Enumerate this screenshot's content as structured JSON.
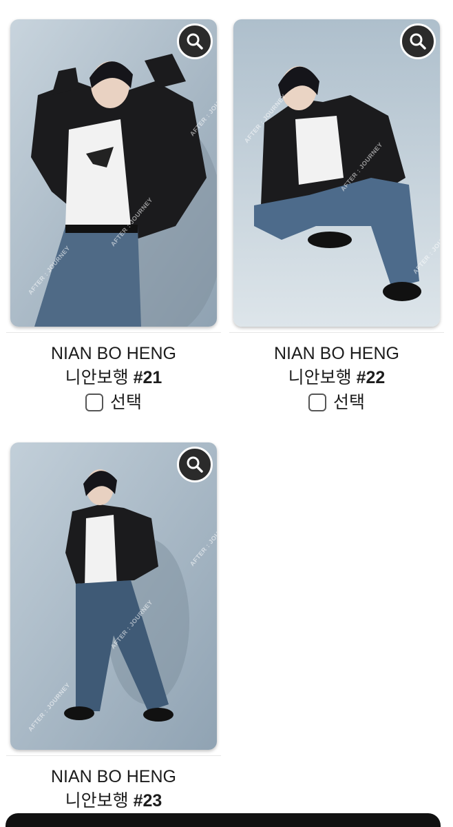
{
  "cards": [
    {
      "name": "NIAN BO HENG",
      "korean_name": "니안보행",
      "number": "#21",
      "select_label": "선택",
      "watermark": "AFTER : JOURNEY"
    },
    {
      "name": "NIAN BO HENG",
      "korean_name": "니안보행",
      "number": "#22",
      "select_label": "선택",
      "watermark": "AFTER : JOURNEY"
    },
    {
      "name": "NIAN BO HENG",
      "korean_name": "니안보행",
      "number": "#23",
      "select_label": "",
      "watermark": "AFTER : JOURNEY"
    }
  ],
  "icons": {
    "zoom": "magnifier-icon",
    "checkbox": "unchecked-checkbox"
  },
  "colors": {
    "zoom_button": "#2b2b2b",
    "photo_background": "#b7c6d2",
    "bottom_bar": "#111111"
  }
}
